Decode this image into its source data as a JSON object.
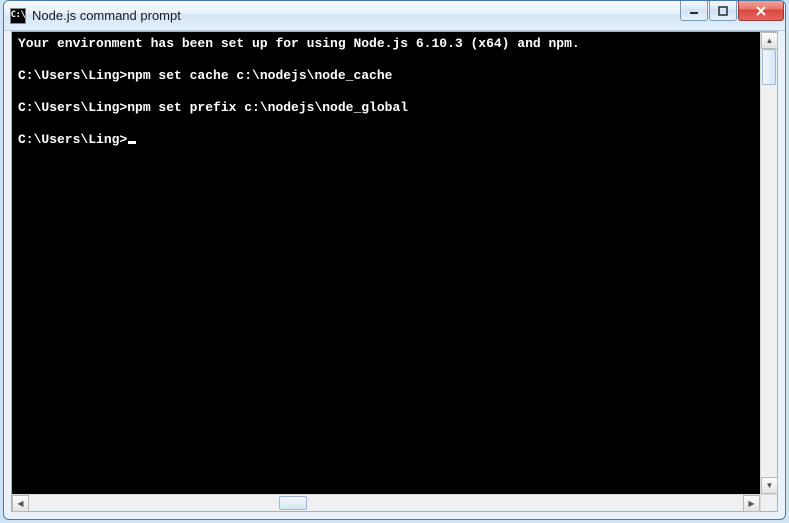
{
  "window": {
    "title": "Node.js command prompt",
    "icon_text": "C:\\"
  },
  "console": {
    "lines": [
      "Your environment has been set up for using Node.js 6.10.3 (x64) and npm.",
      "",
      "C:\\Users\\Ling>npm set cache c:\\nodejs\\node_cache",
      "",
      "C:\\Users\\Ling>npm set prefix c:\\nodejs\\node_global",
      "",
      "C:\\Users\\Ling>"
    ],
    "cursor_on_last": true
  }
}
